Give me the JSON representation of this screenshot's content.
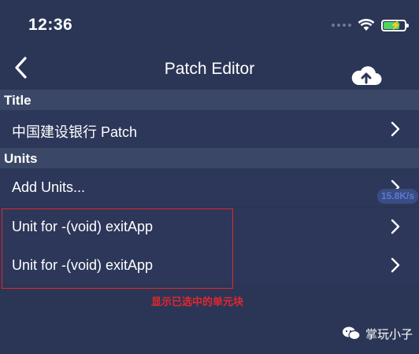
{
  "status_bar": {
    "time": "12:36"
  },
  "nav": {
    "title": "Patch Editor"
  },
  "sections": {
    "title_header": "Title",
    "units_header": "Units"
  },
  "rows": {
    "patch_name": "中国建设银行 Patch",
    "add_units": "Add Units...",
    "unit_1": "Unit for -(void) exitApp",
    "unit_2": "Unit for -(void) exitApp"
  },
  "overlay": {
    "speed": "15.8K/s",
    "annotation": "显示已选中的单元块",
    "watermark": "掌玩小子"
  },
  "colors": {
    "background": "#2b3656",
    "section_header": "#3b4766",
    "annotation_red": "#e6252d",
    "battery_green": "#4fd460"
  }
}
